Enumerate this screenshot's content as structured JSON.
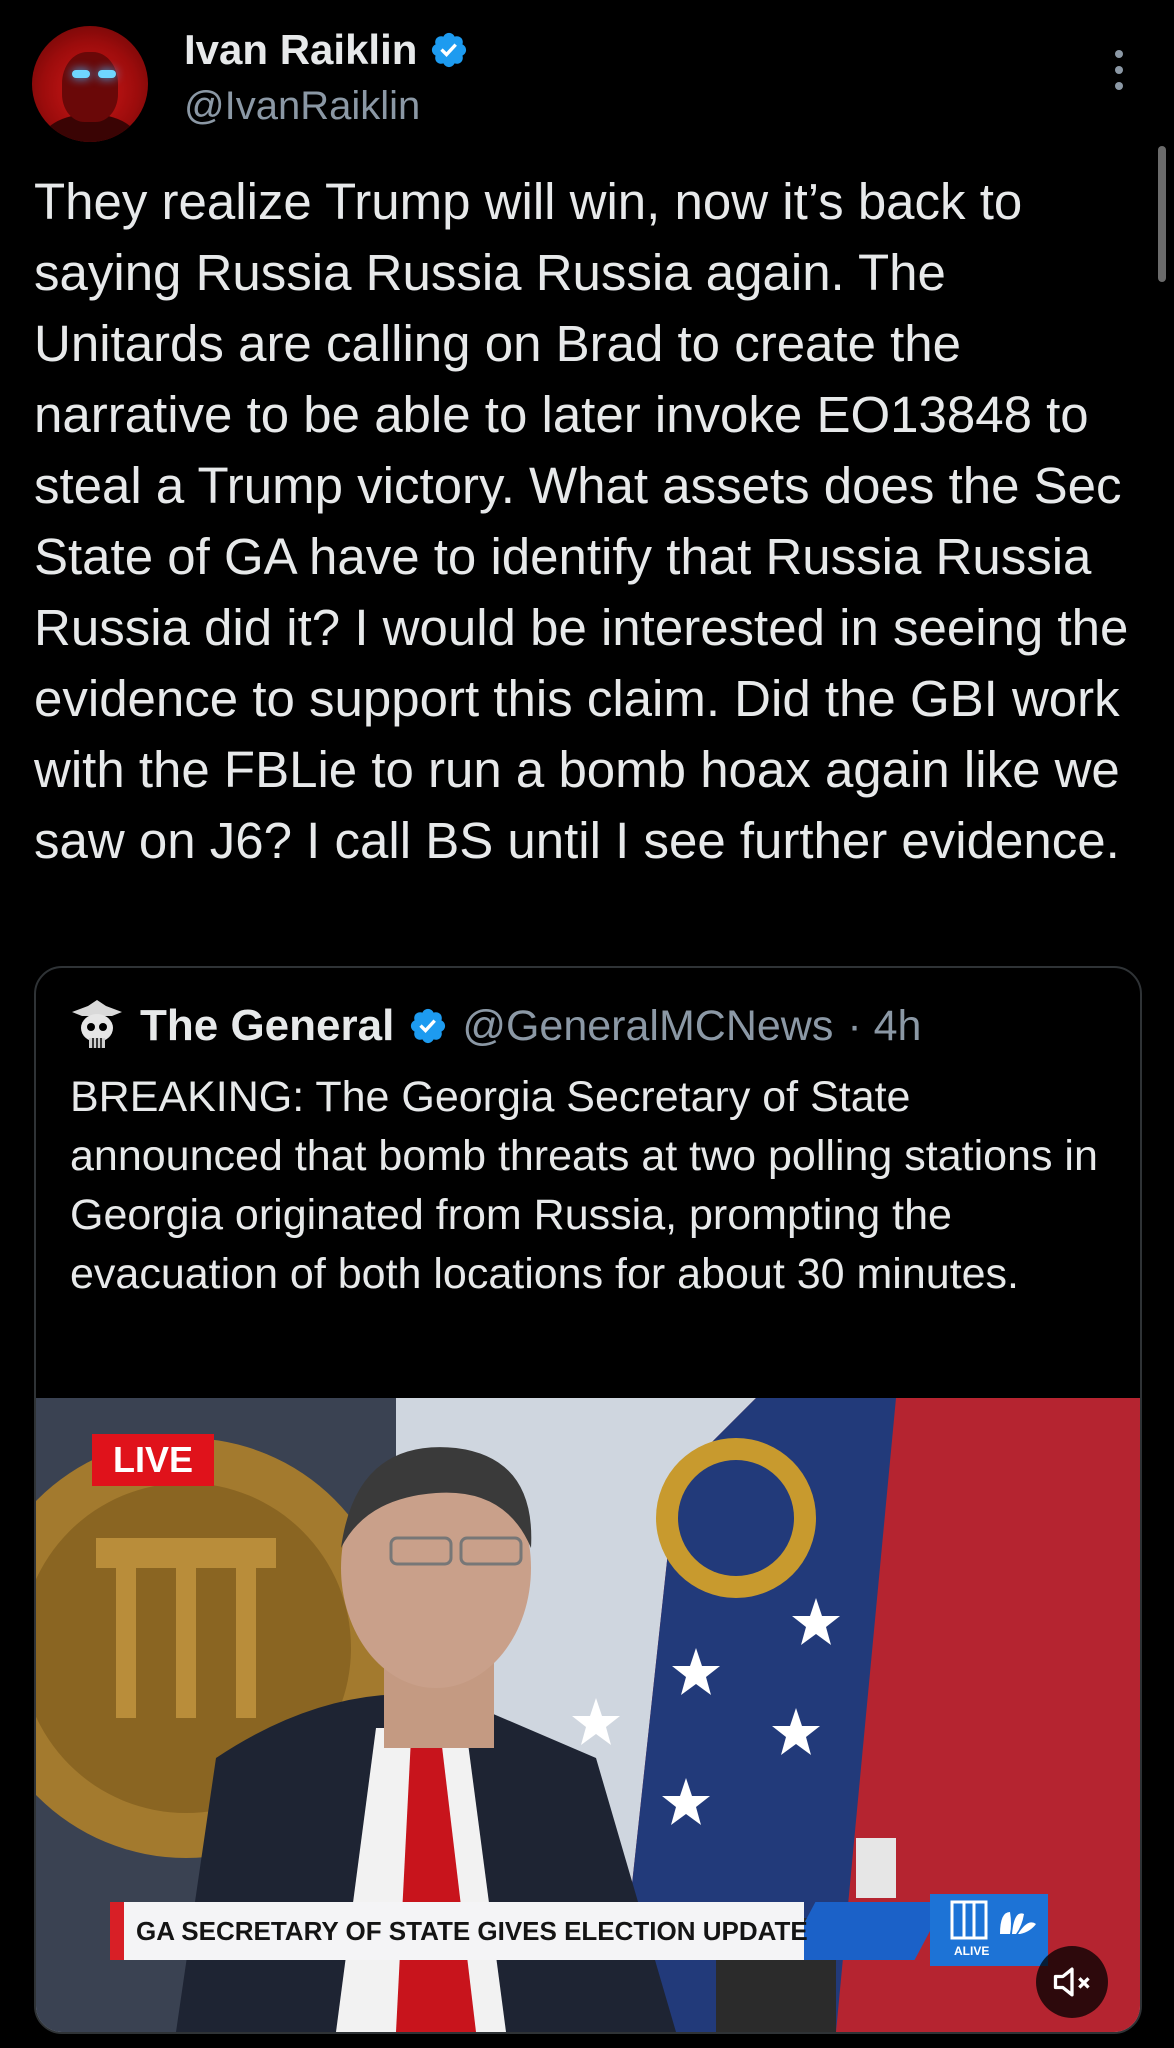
{
  "author": {
    "name": "Ivan Raiklin",
    "handle": "@IvanRaiklin",
    "verified": true
  },
  "tweet": {
    "text": "They realize Trump will win, now it’s back to saying Russia Russia Russia again.  The Unitards are calling on Brad to create the narrative to be able to later invoke EO13848 to steal a Trump victory.  What assets does the Sec State of GA have to identify that Russia Russia Russia did it?  I would be interested in seeing the evidence to support this claim. Did the GBI work with the FBLie to run a bomb hoax again like we saw on J6?  I call BS until I see further evidence."
  },
  "quoted_tweet": {
    "name": "The General",
    "handle": "@GeneralMCNews",
    "time": "· 4h",
    "verified": true,
    "text": "BREAKING: The Georgia Secretary of State announced that bomb threats at two polling stations in Georgia originated from Russia, prompting the evacuation of both locations for about 30 minutes.",
    "media": {
      "live_badge": "LIVE",
      "chyron": "GA SECRETARY OF STATE GIVES ELECTION UPDATE",
      "station_logo": "ALIVE",
      "mute_icon": "speaker-muted-icon"
    }
  },
  "colors": {
    "background": "#000000",
    "text": "#e7e9ea",
    "secondary_text": "#8b98a5",
    "verified_blue": "#1d9bf0",
    "border": "#2f3336",
    "live_red": "#e0121b"
  }
}
